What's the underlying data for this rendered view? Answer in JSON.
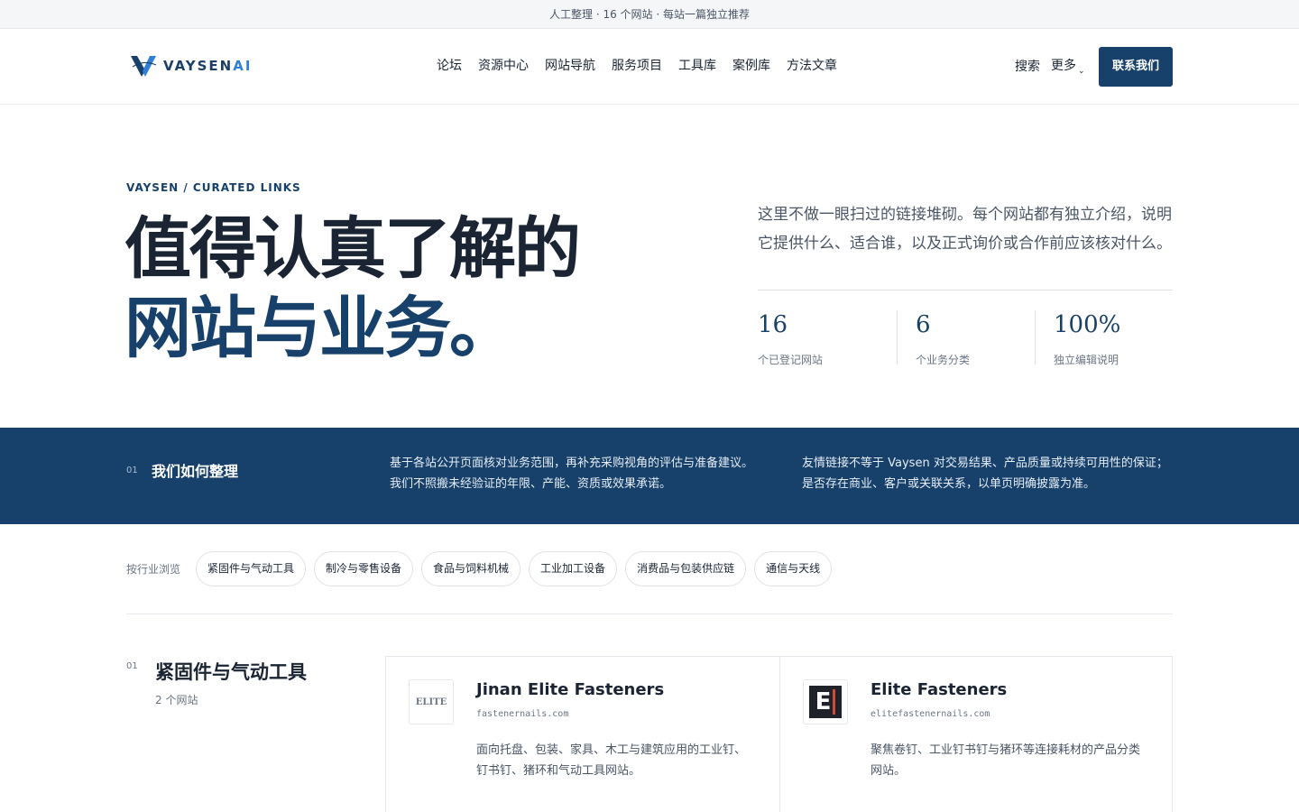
{
  "topbar": {
    "text": "人工整理 · 16 个网站 · 每站一篇独立推荐"
  },
  "header": {
    "logo_text": "VAYSEN",
    "logo_ai": "AI",
    "nav": [
      "论坛",
      "资源中心",
      "网站导航",
      "服务项目",
      "工具库",
      "案例库",
      "方法文章"
    ],
    "search_label": "搜索",
    "more_label": "更多",
    "contact_label": "联系我们"
  },
  "hero": {
    "eyebrow": "VAYSEN / CURATED LINKS",
    "title_line1": "值得认真了解的",
    "title_line2": "网站与业务。",
    "description": "这里不做一眼扫过的链接堆砌。每个网站都有独立介绍，说明它提供什么、适合谁，以及正式询价或合作前应该核对什么。",
    "stats": [
      {
        "value": "16",
        "label": "个已登记网站"
      },
      {
        "value": "6",
        "label": "个业务分类"
      },
      {
        "value": "100%",
        "label": "独立编辑说明"
      }
    ]
  },
  "band": {
    "num": "01",
    "title": "我们如何整理",
    "p1_line1": "基于各站公开页面核对业务范围，再补充采购视角的评估与准备建议。",
    "p1_line2": "我们不照搬未经验证的年限、产能、资质或效果承诺。",
    "p2_line1": "友情链接不等于 Vaysen 对交易结果、产品质量或持续可用性的保证；",
    "p2_line2": "是否存在商业、客户或关联关系，以单页明确披露为准。"
  },
  "filters": {
    "label": "按行业浏览",
    "chips": [
      "紧固件与气动工具",
      "制冷与零售设备",
      "食品与饲料机械",
      "工业加工设备",
      "消费品与包装供应链",
      "通信与天线"
    ]
  },
  "section": {
    "num": "01",
    "title": "紧固件与气动工具",
    "count": "2 个网站",
    "cards": [
      {
        "logo_text": "ELITE",
        "title": "Jinan Elite Fasteners",
        "url": "fastenernails.com",
        "desc_line1": "面向托盘、包装、家具、木工与建筑应用的工业钉、",
        "desc_line2": "钉书钉、猪环和气动工具网站。"
      },
      {
        "logo_text": "E",
        "title": "Elite Fasteners",
        "url": "elitefastenernails.com",
        "desc_line1": "聚焦卷钉、工业钉书钉与猪环等连接耗材的产品分类",
        "desc_line2": "网站。"
      }
    ]
  }
}
